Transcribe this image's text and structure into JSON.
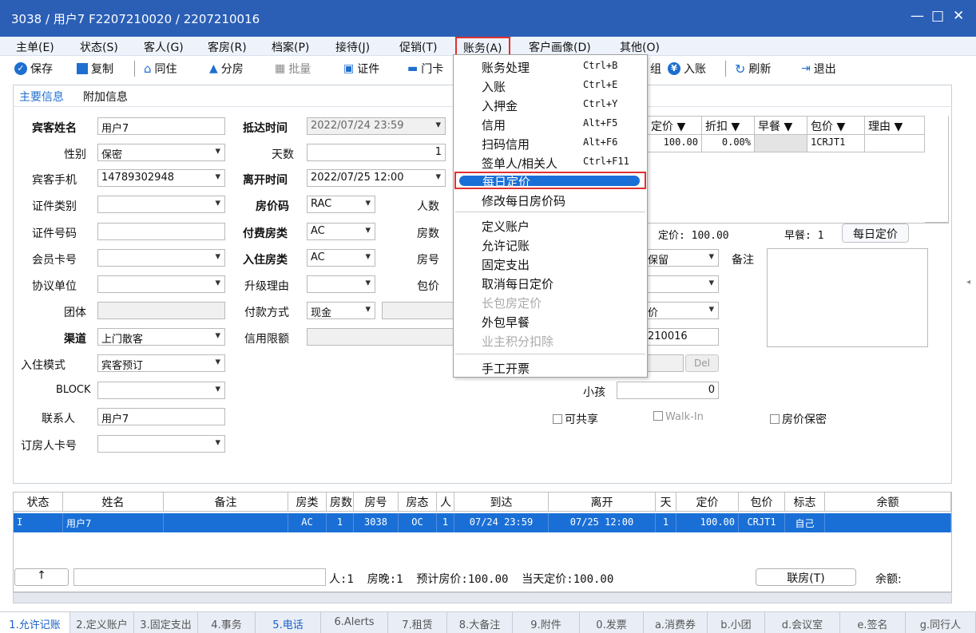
{
  "window": {
    "title": "3038 / 用户7 F2207210020 / 2207210016",
    "minimize": "—",
    "maximize": "□",
    "close": "✕"
  },
  "menubar": [
    "主单(E)",
    "状态(S)",
    "客人(G)",
    "客房(R)",
    "档案(P)",
    "接待(J)",
    "促销(T)",
    "账务(A)",
    "客户画像(D)",
    "其他(O)"
  ],
  "toolbar": {
    "save": "保存",
    "copy": "复制",
    "cohabit": "同住",
    "split": "分房",
    "batch": "批量",
    "certificate": "证件",
    "doorcard": "门卡",
    "post": "入账",
    "refresh": "刷新",
    "exit": "退出",
    "partial": "组"
  },
  "tabs": {
    "main": "主要信息",
    "extra": "附加信息"
  },
  "form": {
    "guest_name_label": "宾客姓名",
    "guest_name": "用户7",
    "gender_label": "性别",
    "gender": "保密",
    "mobile_label": "宾客手机",
    "mobile": "14789302948",
    "id_type_label": "证件类别",
    "id_type": "",
    "id_no_label": "证件号码",
    "id_no": "",
    "member_label": "会员卡号",
    "member": "",
    "agreement_label": "协议单位",
    "agreement": "",
    "group_label": "团体",
    "group": "",
    "channel_label": "渠道",
    "channel": "上门散客",
    "checkin_mode_label": "入住模式",
    "checkin_mode": "宾客预订",
    "block_label": "BLOCK",
    "block": "",
    "contact_label": "联系人",
    "contact": "用户7",
    "booker_card_label": "订房人卡号",
    "booker_card": "",
    "arrival_label": "抵达时间",
    "arrival": "2022/07/24 23:59",
    "days_label": "天数",
    "days": "1",
    "departure_label": "离开时间",
    "departure": "2022/07/25 12:00",
    "rate_code_label": "房价码",
    "rate_code": "RAC",
    "pay_room_type_label": "付费房类",
    "pay_room_type": "AC",
    "room_type_label": "入住房类",
    "room_type": "AC",
    "upgrade_label": "升级理由",
    "upgrade": "",
    "payment_label": "付款方式",
    "payment": "现金",
    "credit_label": "信用限额",
    "credit": "",
    "persons_label": "人数",
    "rooms_label": "房数",
    "roomno_label": "房号",
    "package_label": "包价",
    "retain": "保留",
    "price_partial": "价",
    "account_partial": "210016",
    "del_btn": "Del",
    "child_label": "小孩",
    "child": "0",
    "shareable": "可共享",
    "walkin": "Walk-In",
    "price_secret": "房价保密",
    "remark_label": "备注"
  },
  "rate_grid": {
    "headers": [
      "定价 ▼",
      "折扣 ▼",
      "早餐 ▼",
      "包价 ▼",
      "理由 ▼"
    ],
    "row": [
      "100.00",
      "0.00%",
      "",
      "1CRJT1",
      ""
    ],
    "summary_price": "定价: 100.00",
    "summary_breakfast": "早餐: 1",
    "daily_price_btn": "每日定价"
  },
  "menu_items": [
    {
      "label": "账务处理",
      "shortcut": "Ctrl+B"
    },
    {
      "label": "入账",
      "shortcut": "Ctrl+E"
    },
    {
      "label": "入押金",
      "shortcut": "Ctrl+Y"
    },
    {
      "label": "信用",
      "shortcut": "Alt+F5"
    },
    {
      "label": "扫码信用",
      "shortcut": "Alt+F6"
    },
    {
      "label": "签单人/相关人",
      "shortcut": "Ctrl+F11"
    },
    {
      "label": "每日定价",
      "shortcut": ""
    },
    {
      "label": "修改每日房价码",
      "shortcut": ""
    },
    {
      "label": "定义账户",
      "shortcut": ""
    },
    {
      "label": "允许记账",
      "shortcut": ""
    },
    {
      "label": "固定支出",
      "shortcut": ""
    },
    {
      "label": "取消每日定价",
      "shortcut": ""
    },
    {
      "label": "长包房定价",
      "shortcut": ""
    },
    {
      "label": "外包早餐",
      "shortcut": ""
    },
    {
      "label": "业主积分扣除",
      "shortcut": ""
    },
    {
      "label": "手工开票",
      "shortcut": ""
    }
  ],
  "list": {
    "headers": [
      "状态",
      "姓名",
      "备注",
      "房类",
      "房数",
      "房号",
      "房态",
      "人",
      "到达",
      "离开",
      "天",
      "定价",
      "包价",
      "标志",
      "余额"
    ],
    "rows": [
      [
        "I",
        "用户7",
        "",
        "AC",
        "1",
        "3038",
        "OC",
        "1",
        "07/24 23:59",
        "07/25 12:00",
        "1",
        "100.00",
        "CRJT1",
        "自己",
        ""
      ]
    ]
  },
  "footer": {
    "up": "↑",
    "summary": "人:1  房晚:1  预计房价:100.00  当天定价:100.00",
    "link_room": "联房(T)",
    "balance": "余额:"
  },
  "statusbar": [
    "1.允许记账",
    "2.定义账户",
    "3.固定支出",
    "4.事务",
    "5.电话",
    "6.Alerts",
    "7.租赁",
    "8.大备注",
    "9.附件",
    "0.发票",
    "a.消费券",
    "b.小团",
    "d.会议室",
    "e.签名",
    "g.同行人"
  ],
  "colors": {
    "title_bg": "#2b5fb6",
    "highlight": "#1a6fd6",
    "red_box": "#e03030"
  }
}
